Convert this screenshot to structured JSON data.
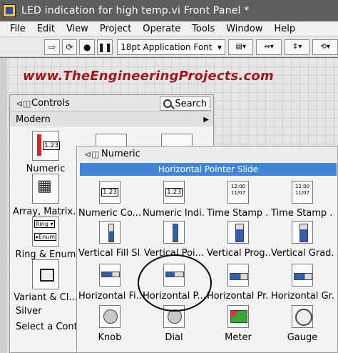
{
  "window": {
    "title": "LED indication for high temp.vi Front Panel *"
  },
  "menu": [
    "File",
    "Edit",
    "View",
    "Project",
    "Operate",
    "Tools",
    "Window",
    "Help"
  ],
  "toolbar": {
    "font_label": "18pt Application Font",
    "buttons": [
      "⇨",
      "⟳",
      "●",
      "❚❚"
    ],
    "drops": [
      "▤▾",
      "⇔▾",
      "⇕▾",
      "⟲▾"
    ]
  },
  "watermark": "www.TheEngineeringProjects.com",
  "controls_palette": {
    "title": "Controls",
    "search_label": "Search",
    "modern_label": "Modern",
    "items": [
      {
        "label": "Numeric"
      },
      {
        "label": "Array, Matrix..."
      },
      {
        "label": "Ring & Enum"
      },
      {
        "label": "Variant & Cl..."
      }
    ],
    "silver_label": "Silver",
    "select_label": "Select a Contro"
  },
  "numeric_palette": {
    "title": "Numeric",
    "tooltip": "Horizontal Pointer Slide",
    "items": [
      {
        "label": "Numeric Co..."
      },
      {
        "label": "Numeric Indi..."
      },
      {
        "label": "Time Stamp ..."
      },
      {
        "label": "Time Stamp ..."
      },
      {
        "label": "Vertical Fill Sl..."
      },
      {
        "label": "Vertical Poi..."
      },
      {
        "label": "Vertical Prog..."
      },
      {
        "label": "Vertical Grad..."
      },
      {
        "label": "Horizontal Fi..."
      },
      {
        "label": "Horizontal P..."
      },
      {
        "label": "Horizontal Pr..."
      },
      {
        "label": "Horizontal Gr..."
      },
      {
        "label": "Knob"
      },
      {
        "label": "Dial"
      },
      {
        "label": "Meter"
      },
      {
        "label": "Gauge"
      }
    ]
  }
}
